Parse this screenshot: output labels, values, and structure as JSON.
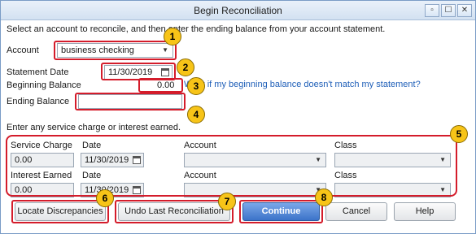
{
  "window": {
    "title": "Begin Reconciliation",
    "controls": [
      "▫",
      "☐",
      "✕"
    ]
  },
  "instructions": "Select an account to reconcile, and then enter the ending balance from your account statement.",
  "account": {
    "label": "Account",
    "value": "business checking"
  },
  "statement_date": {
    "label": "Statement Date",
    "value": "11/30/2019"
  },
  "beginning_balance": {
    "label": "Beginning Balance",
    "value": "0.00",
    "help_link": "What if my beginning balance doesn't match my statement?"
  },
  "ending_balance": {
    "label": "Ending Balance",
    "value": ""
  },
  "service_section": {
    "heading": "Enter any service charge or interest earned.",
    "service_charge": {
      "label": "Service Charge",
      "value": "0.00",
      "date_label": "Date",
      "date_value": "11/30/2019",
      "account_label": "Account",
      "class_label": "Class"
    },
    "interest_earned": {
      "label": "Interest Earned",
      "value": "0.00",
      "date_label": "Date",
      "date_value": "11/30/2019",
      "account_label": "Account",
      "class_label": "Class"
    }
  },
  "buttons": {
    "locate": "Locate Discrepancies",
    "undo": "Undo Last Reconciliation",
    "continue": "Continue",
    "cancel": "Cancel",
    "help": "Help"
  },
  "callouts": [
    "1",
    "2",
    "3",
    "4",
    "5",
    "6",
    "7",
    "8"
  ],
  "colors": {
    "highlight": "#d41c2b",
    "badge": "#f7c418",
    "primary_button": "#3b73c9",
    "link": "#1f5fb8"
  }
}
